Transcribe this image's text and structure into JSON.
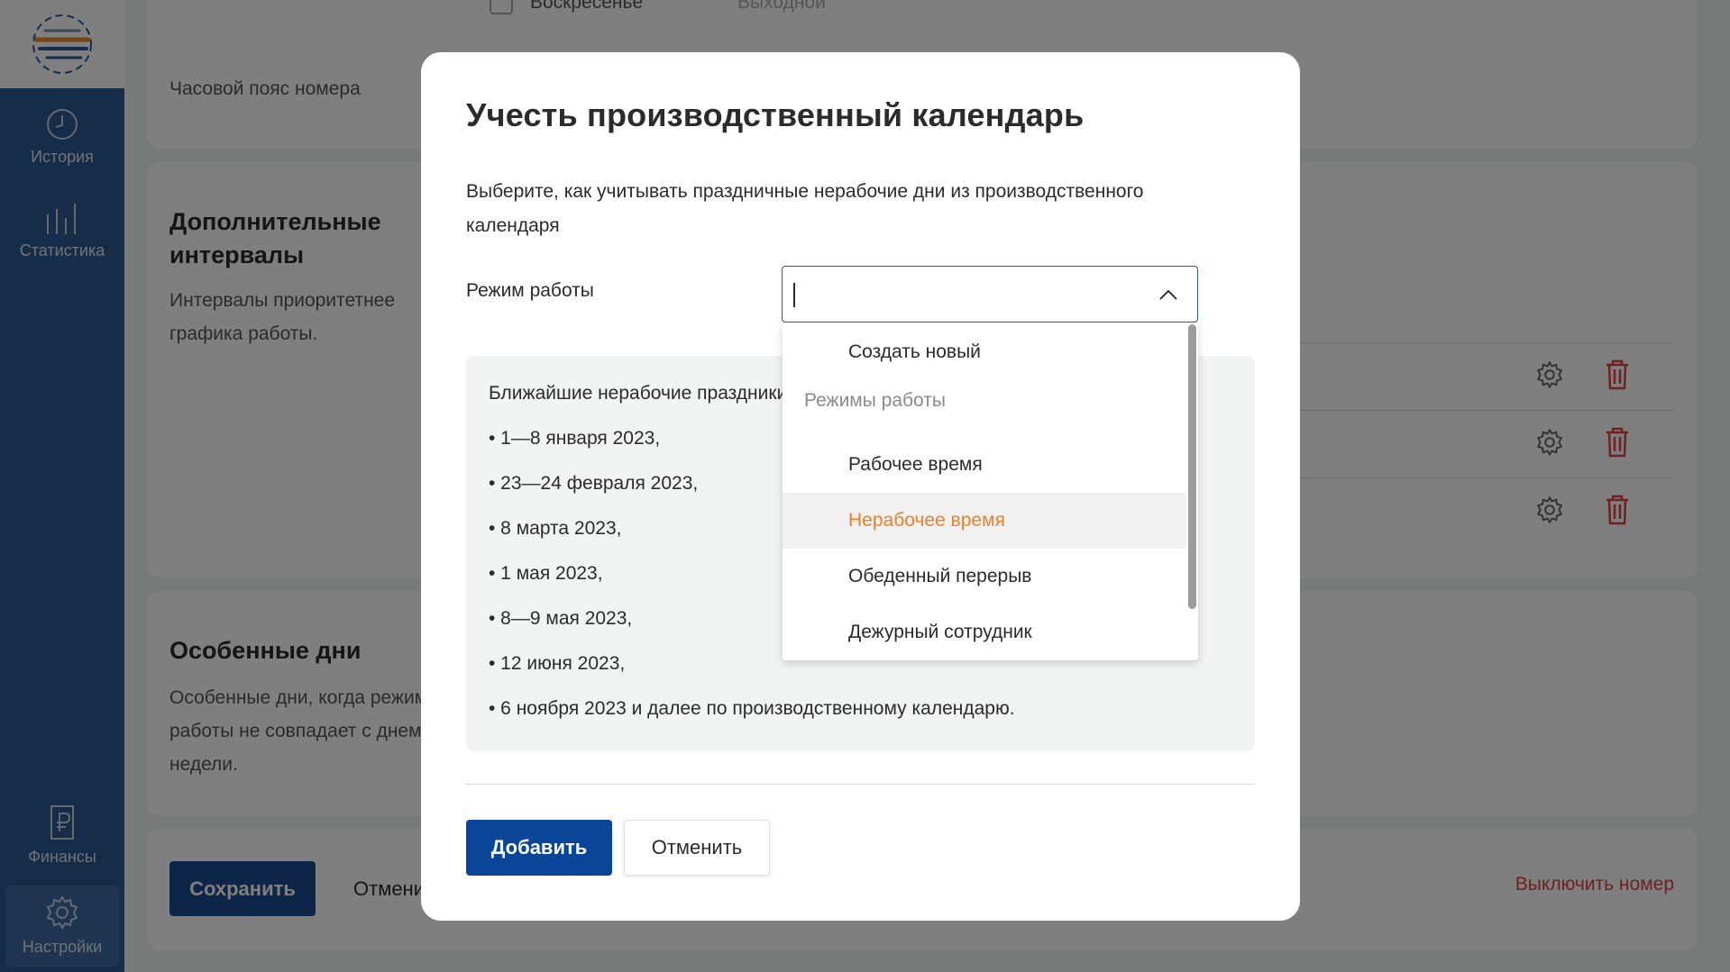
{
  "sidebar": {
    "items": [
      {
        "label": "История",
        "icon": "clock-icon"
      },
      {
        "label": "Статистика",
        "icon": "bar-chart-icon"
      },
      {
        "label": "Финансы",
        "icon": "ruble-document-icon"
      },
      {
        "label": "Настройки",
        "icon": "gear-icon"
      }
    ]
  },
  "background": {
    "top_checkbox_label": "Воскресенье",
    "top_day_type": "Выходной",
    "timezone_label": "Часовой пояс номера",
    "intervals_title": "Дополнительные интервалы",
    "intervals_desc": "Интервалы приоритетнее графика работы.",
    "special_days_title": "Особенные дни",
    "special_days_desc": "Особенные дни, когда режим работы не совпадает с днем недели.",
    "save_label": "Сохранить",
    "cancel_label": "Отменить",
    "disable_number_label": "Выключить номер"
  },
  "modal": {
    "title": "Учесть производственный календарь",
    "description": "Выберите, как учитывать праздничные нерабочие дни из производственного календаря",
    "mode_label": "Режим работы",
    "mode_value": "",
    "holidays_heading": "Ближайшие нерабочие праздники:",
    "holidays": [
      "• 1—8 января 2023,",
      "• 23—24 февраля 2023,",
      "• 8 марта 2023,",
      "• 1 мая 2023,",
      "• 8—9 мая 2023,",
      "• 12 июня 2023,",
      "• 6 ноября 2023 и далее по производственному календарю."
    ],
    "add_label": "Добавить",
    "cancel_label": "Отменить"
  },
  "dropdown": {
    "create_new": "Создать новый",
    "group_label": "Режимы работы",
    "options": [
      "Рабочее время",
      "Нерабочее время",
      "Обеденный перерыв",
      "Дежурный сотрудник"
    ],
    "hovered_index": 1
  },
  "colors": {
    "sidebar": "#2c5a93",
    "primary_button": "#0b4597",
    "hover_text": "#f07f24",
    "danger": "#e04040"
  }
}
